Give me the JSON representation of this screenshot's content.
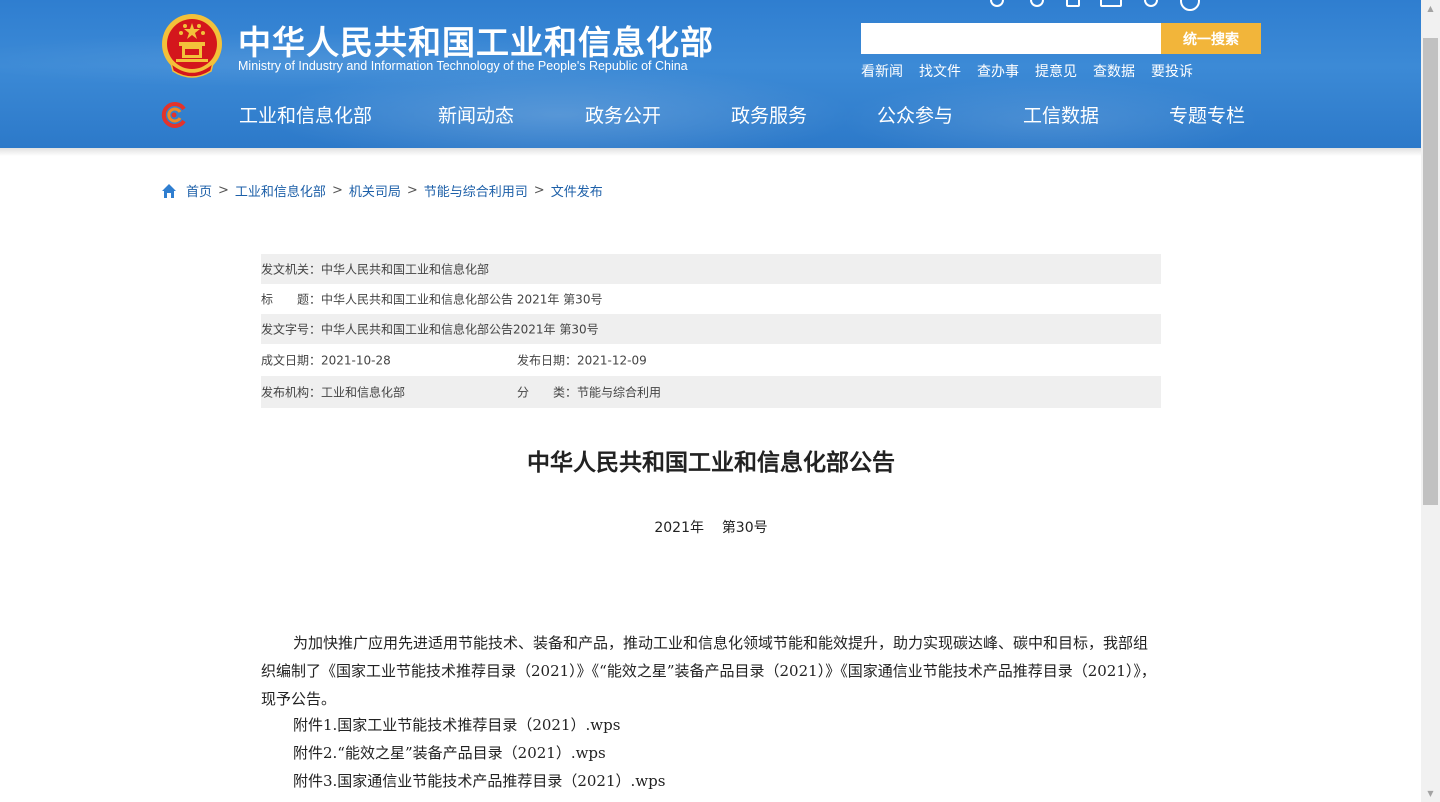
{
  "header": {
    "title_cn": "中华人民共和国工业和信息化部",
    "title_en": "Ministry of Industry and Information Technology of the People's Republic of China",
    "search_placeholder": "",
    "search_button": "统一搜索",
    "quick_links": [
      "看新闻",
      "找文件",
      "查办事",
      "提意见",
      "查数据",
      "要投诉"
    ],
    "nav": [
      "工业和信息化部",
      "新闻动态",
      "政务公开",
      "政务服务",
      "公众参与",
      "工信数据",
      "专题专栏"
    ],
    "colors": {
      "header_blue": "#3c8ad6",
      "search_button": "#f2b53a",
      "emblem_red": "#d4161c",
      "emblem_gold": "#f3c13a"
    }
  },
  "breadcrumb": [
    "首页",
    "工业和信息化部",
    "机关司局",
    "节能与综合利用司",
    "文件发布"
  ],
  "info": {
    "issuer_label": "发文机关：",
    "issuer": "中华人民共和国工业和信息化部",
    "title_label": "标　　题：",
    "title": "中华人民共和国工业和信息化部公告 2021年 第30号",
    "doc_no_label": "发文字号：",
    "doc_no": "中华人民共和国工业和信息化部公告2021年 第30号",
    "created_label": "成文日期：",
    "created": "2021-10-28",
    "published_label": "发布日期：",
    "published": "2021-12-09",
    "org_label": "发布机构：",
    "org": "工业和信息化部",
    "category_label": "分　　类：",
    "category": "节能与综合利用"
  },
  "article": {
    "title": "中华人民共和国工业和信息化部公告",
    "year": "2021年",
    "number": "第30号",
    "paragraph": "为加快推广应用先进适用节能技术、装备和产品，推动工业和信息化领域节能和能效提升，助力实现碳达峰、碳中和目标，我部组织编制了《国家工业节能技术推荐目录（2021）》《“能效之星”装备产品目录（2021）》《国家通信业节能技术产品推荐目录（2021）》，现予公告。",
    "attachments": [
      "附件1.国家工业节能技术推荐目录（2021）.wps",
      "附件2.“能效之星”装备产品目录（2021）.wps",
      "附件3.国家通信业节能技术产品推荐目录（2021）.wps"
    ]
  }
}
